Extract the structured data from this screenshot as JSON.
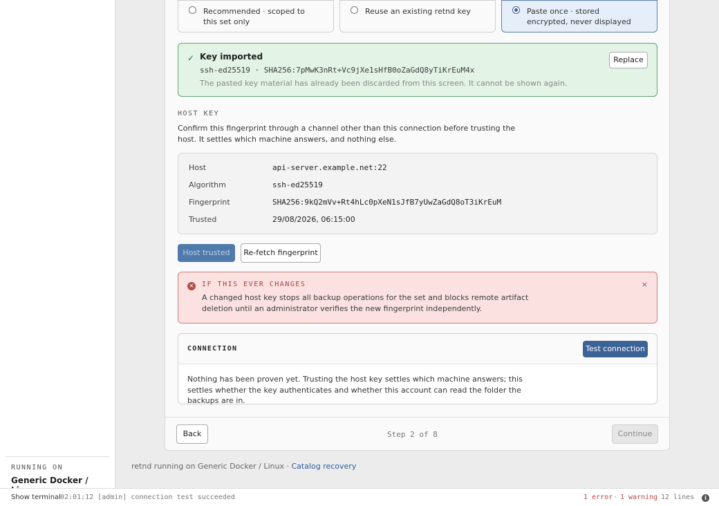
{
  "sidebar": {
    "running_on_label": "RUNNING ON",
    "running_on_value": "Generic Docker / Linux"
  },
  "key_options": [
    {
      "label": "Recommended · scoped to this set only",
      "selected": false
    },
    {
      "label": "Reuse an existing retnd key",
      "selected": false
    },
    {
      "label": "Paste once · stored encrypted, never displayed",
      "selected": true
    }
  ],
  "imported": {
    "check": "✓",
    "title": "Key imported",
    "fingerprint": "ssh-ed25519 · SHA256:7pMwK3nRt+Vc9jXe1sHfB0oZaGdQ8yTiKrEuM4x",
    "note": "The pasted key material has already been discarded from this screen. It cannot be shown again.",
    "replace_label": "Replace"
  },
  "host_key": {
    "section_label": "HOST KEY",
    "description": "Confirm this fingerprint through a channel other than this connection before trusting the host. It settles which machine answers, and nothing else.",
    "rows": [
      {
        "label": "Host",
        "value": "api-server.example.net:22"
      },
      {
        "label": "Algorithm",
        "value": "ssh-ed25519"
      },
      {
        "label": "Fingerprint",
        "value": "SHA256:9kQ2mVv+Rt4hLc0pXeN1sJfB7yUwZaGdQ8oT3iKrEuM"
      },
      {
        "label": "Trusted",
        "value": "29/08/2026, 06:15:00"
      }
    ],
    "trusted_button": "Host trusted",
    "refetch_button": "Re-fetch fingerprint"
  },
  "alert": {
    "icon": "×",
    "title": "IF THIS EVER CHANGES",
    "body": "A changed host key stops all backup operations for the set and blocks remote artifact deletion until an administrator verifies the new fingerprint independently.",
    "close": "×"
  },
  "connection": {
    "label": "CONNECTION",
    "test_button": "Test connection",
    "body": "Nothing has been proven yet. Trusting the host key settles which machine answers; this settles whether the key authenticates and whether this account can read the folder the backups are in."
  },
  "footer": {
    "back": "Back",
    "step": "Step 2 of 8",
    "continue": "Continue"
  },
  "run_line": {
    "text": "retnd running on Generic Docker / Linux · ",
    "link": "Catalog recovery"
  },
  "statusbar": {
    "show_terminal": "Show terminal",
    "log": "02:01:12 [admin] connection test succeeded",
    "errors": "1 error",
    "sep": "·",
    "warnings": "1 warning",
    "lines": "12 lines",
    "info": "i"
  }
}
